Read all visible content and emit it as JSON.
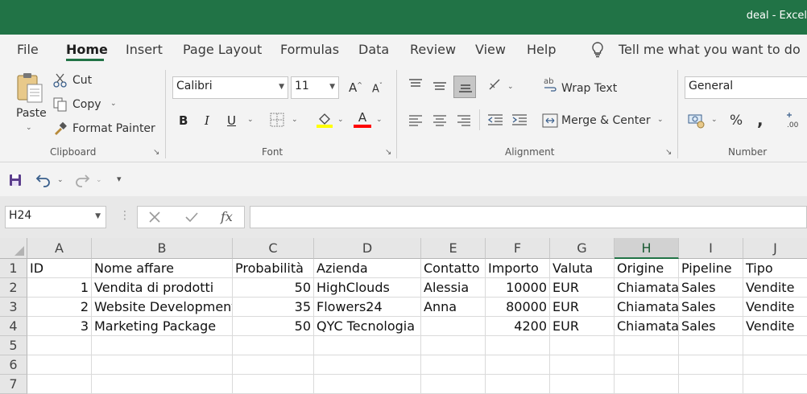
{
  "title_bar": {
    "title": "deal  -  Excel"
  },
  "tabs": [
    "File",
    "Home",
    "Insert",
    "Page Layout",
    "Formulas",
    "Data",
    "Review",
    "View",
    "Help"
  ],
  "tell_me": "Tell me what you want to do",
  "clipboard": {
    "paste": "Paste",
    "cut": "Cut",
    "copy": "Copy",
    "format_painter": "Format Painter",
    "label": "Clipboard"
  },
  "font": {
    "name": "Calibri",
    "size": "11",
    "bold": "B",
    "italic": "I",
    "underline": "U",
    "label": "Font",
    "grow": "A",
    "shrink": "A",
    "font_color_glyph": "A"
  },
  "font_colors": {
    "highlight": "#ffff00",
    "font": "#ff0000"
  },
  "alignment": {
    "wrap_text": "Wrap Text",
    "merge_center": "Merge & Center",
    "label": "Alignment"
  },
  "number": {
    "format": "General",
    "percent": "%",
    "comma": ",",
    "label": "Number"
  },
  "formula_bar": {
    "name_box": "H24",
    "fx": "fx",
    "formula": ""
  },
  "accent": "#217346",
  "sheet": {
    "selected_column": "H",
    "columns": [
      "A",
      "B",
      "C",
      "D",
      "E",
      "F",
      "G",
      "H",
      "I",
      "J"
    ],
    "rows": [
      {
        "n": "1",
        "cells": [
          "ID",
          "Nome affare",
          "Probabilità",
          "Azienda",
          "Contatto",
          "Importo",
          "Valuta",
          "Origine",
          "Pipeline",
          "Tipo"
        ]
      },
      {
        "n": "2",
        "cells": [
          "1",
          "Vendita di prodotti",
          "50",
          "HighClouds",
          "Alessia",
          "10000",
          "EUR",
          "Chiamata",
          "Sales",
          "Vendite"
        ]
      },
      {
        "n": "3",
        "cells": [
          "2",
          "Website Development",
          "35",
          "Flowers24",
          "Anna",
          "80000",
          "EUR",
          "Chiamata",
          "Sales",
          "Vendite"
        ]
      },
      {
        "n": "4",
        "cells": [
          "3",
          "Marketing Package",
          "50",
          "QYC Tecnologia",
          "",
          "4200",
          "EUR",
          "Chiamata",
          "Sales",
          "Vendite"
        ]
      },
      {
        "n": "5",
        "cells": [
          "",
          "",
          "",
          "",
          "",
          "",
          "",
          "",
          "",
          ""
        ]
      },
      {
        "n": "6",
        "cells": [
          "",
          "",
          "",
          "",
          "",
          "",
          "",
          "",
          "",
          ""
        ]
      },
      {
        "n": "7",
        "cells": [
          "",
          "",
          "",
          "",
          "",
          "",
          "",
          "",
          "",
          ""
        ]
      }
    ]
  }
}
